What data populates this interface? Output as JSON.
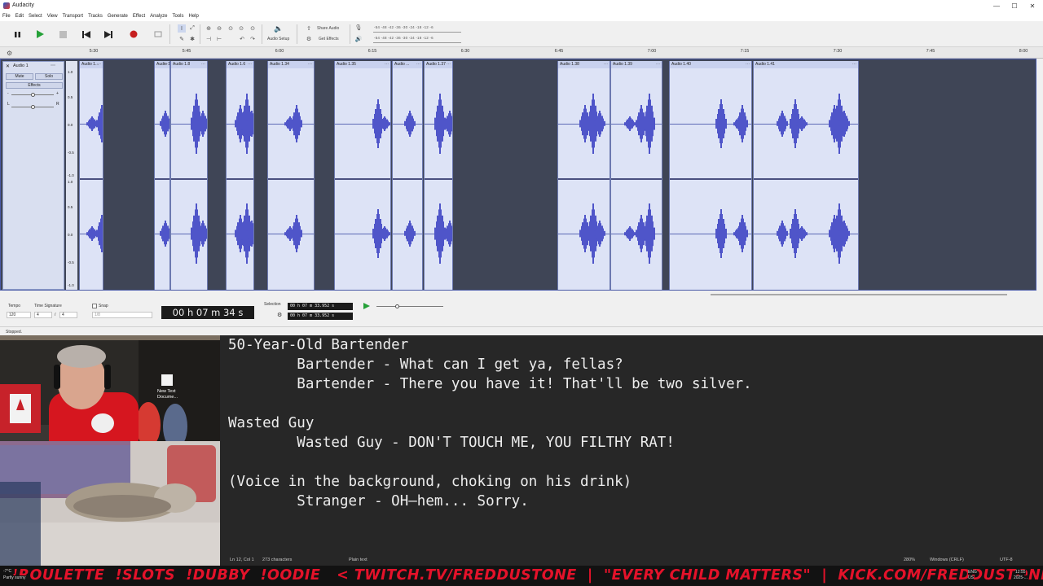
{
  "window": {
    "title": "Audacity",
    "minimize": "—",
    "maximize": "☐",
    "close": "✕"
  },
  "menu": [
    "File",
    "Edit",
    "Select",
    "View",
    "Transport",
    "Tracks",
    "Generate",
    "Effect",
    "Analyze",
    "Tools",
    "Help"
  ],
  "toolbar": {
    "audio_setup": "Audio Setup",
    "share_audio": "Share Audio",
    "get_effects": "Get Effects",
    "meter_ticks": "-54 -48 -42 -36 -30 -24 -18 -12 -6",
    "meter_ticks_play": "-54 -48 -42 -36 -30 -24 -18 -12 -6"
  },
  "ruler": {
    "ticks": [
      "5:30",
      "5:45",
      "6:00",
      "6:15",
      "6:30",
      "6:45",
      "7:00",
      "7:15",
      "7:30",
      "7:45",
      "8:00"
    ]
  },
  "track": {
    "name": "Audio 1",
    "mute": "Mute",
    "solo": "Solo",
    "effects": "Effects",
    "gain_min": "-",
    "gain_max": "+",
    "pan_left": "L",
    "pan_right": "R",
    "scale": [
      "1.0",
      "0.5",
      "0.0",
      "-0.5",
      "-1.0"
    ],
    "clips": [
      {
        "label": "Audio 1..."
      },
      {
        "label": "Audio 1..."
      },
      {
        "label": "Audio 1.8"
      },
      {
        "label": "Audio 1.6"
      },
      {
        "label": "Audio 1.34"
      },
      {
        "label": "Audio 1.35"
      },
      {
        "label": "Audio ..."
      },
      {
        "label": "Audio 1.37"
      },
      {
        "label": "Audio 1.38"
      },
      {
        "label": "Audio 1.39"
      },
      {
        "label": "Audio 1.40"
      },
      {
        "label": "Audio 1.41"
      }
    ]
  },
  "bottom": {
    "tempo_label": "Tempo",
    "tempo_value": "120",
    "time_sig_label": "Time Signature",
    "time_sig_num": "4",
    "time_sig_slash": "/",
    "time_sig_den": "4",
    "snap_label": "Snap",
    "snap_value": "1/8",
    "time_display": "00 h 07 m 34 s",
    "selection_label": "Selection",
    "selection_start": "00 h 07 m 33.952 s",
    "selection_end": "00 h 07 m 33.952 s"
  },
  "status": "Stopped.",
  "notepad": {
    "lines": [
      "50-Year-Old Bartender",
      "        Bartender - What can I get ya, fellas?",
      "        Bartender - There you have it! That'll be two silver.",
      "",
      "Wasted Guy",
      "        Wasted Guy - DON'T TOUCH ME, YOU FILTHY RAT!",
      "",
      "(Voice in the background, choking on his drink)",
      "        Stranger - OH—hem... Sorry."
    ],
    "status_position": "Ln 12, Col 1",
    "status_chars": "273 characters",
    "status_format": "Plain text",
    "status_zoom": "280%",
    "status_eol": "Windows (CRLF)",
    "status_encoding": "UTF-8"
  },
  "desktop_icon": {
    "label_line1": "New Text",
    "label_line2": "Docume..."
  },
  "ticker": {
    "text": "!ROULETTE  !SLOTS  !DUBBY  !OODIE   < TWITCH.TV/FREDDUSTONE  |  \"EVERY CHILD MATTERS\"  |  KICK.COM/FREDDUSTONE  > !FANGS"
  },
  "tray": {
    "weather": "-7°C",
    "weather_sub": "Partly sunny",
    "lang": "ENG",
    "lang_sub": "US",
    "time": "12:55",
    "date": "2025-..."
  },
  "colors": {
    "waveform": "#4f55c9",
    "clip_bg": "#dde3f6",
    "track_bg": "#3f4556",
    "ticker_red": "#e4122a",
    "record_red": "#c61f1f",
    "play_green": "#25a138"
  }
}
